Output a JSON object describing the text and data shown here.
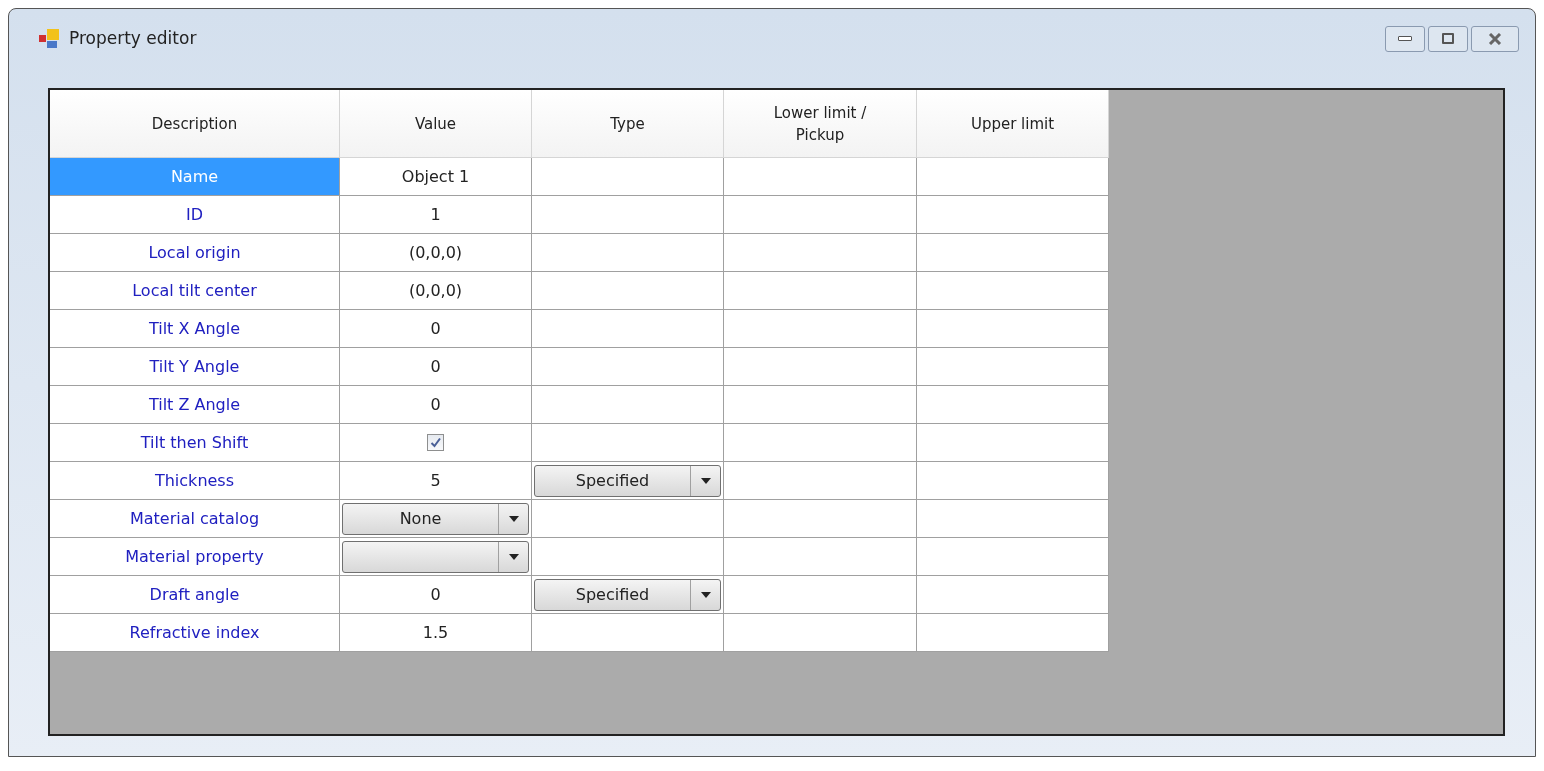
{
  "window": {
    "title": "Property editor"
  },
  "columns": [
    "Description",
    "Value",
    "Type",
    "Lower limit / Pickup",
    "Upper limit"
  ],
  "rows": [
    {
      "description": "Name",
      "selected": true,
      "value": {
        "kind": "text",
        "text": "Object 1"
      }
    },
    {
      "description": "ID",
      "selected": false,
      "value": {
        "kind": "text",
        "text": "1"
      }
    },
    {
      "description": "Local origin",
      "selected": false,
      "value": {
        "kind": "text",
        "text": "(0,0,0)"
      }
    },
    {
      "description": "Local tilt center",
      "selected": false,
      "value": {
        "kind": "text",
        "text": "(0,0,0)"
      }
    },
    {
      "description": "Tilt X Angle",
      "selected": false,
      "value": {
        "kind": "text",
        "text": "0"
      }
    },
    {
      "description": "Tilt Y Angle",
      "selected": false,
      "value": {
        "kind": "text",
        "text": "0"
      }
    },
    {
      "description": "Tilt Z Angle",
      "selected": false,
      "value": {
        "kind": "text",
        "text": "0"
      }
    },
    {
      "description": "Tilt then Shift",
      "selected": false,
      "value": {
        "kind": "checkbox",
        "checked": true
      }
    },
    {
      "description": "Thickness",
      "selected": false,
      "value": {
        "kind": "text",
        "text": "5"
      },
      "type": {
        "kind": "dropdown",
        "text": "Specified"
      }
    },
    {
      "description": "Material catalog",
      "selected": false,
      "value": {
        "kind": "dropdown",
        "text": "None"
      }
    },
    {
      "description": "Material property",
      "selected": false,
      "value": {
        "kind": "dropdown"
      }
    },
    {
      "description": "Draft angle",
      "selected": false,
      "value": {
        "kind": "text",
        "text": "0"
      },
      "type": {
        "kind": "dropdown",
        "text": "Specified"
      }
    },
    {
      "description": "Refractive index",
      "selected": false,
      "value": {
        "kind": "text",
        "text": "1.5"
      }
    }
  ]
}
